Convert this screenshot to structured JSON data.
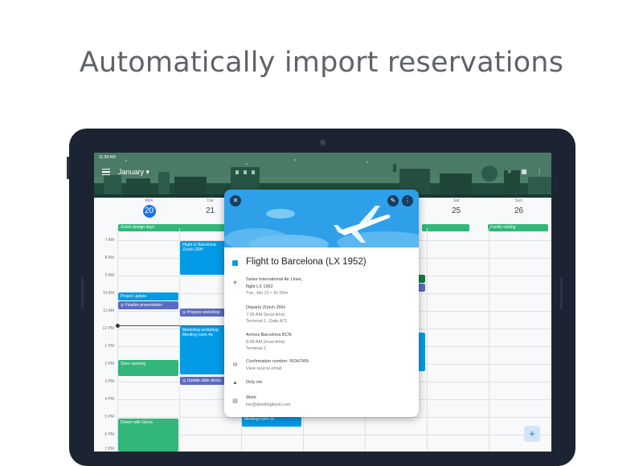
{
  "headline": "Automatically import reservations",
  "status": {
    "time": "11:58 AM"
  },
  "appbar": {
    "month": "January"
  },
  "days": [
    {
      "dow": "Mon",
      "num": "20",
      "today": true
    },
    {
      "dow": "Tue",
      "num": "21"
    },
    {
      "dow": "Sat",
      "num": "25"
    },
    {
      "dow": "Sun",
      "num": "26"
    }
  ],
  "allday": [
    {
      "label": "Zürich design days"
    },
    {
      "label": "Family visiting"
    }
  ],
  "times": [
    "7 AM",
    "8 AM",
    "9 AM",
    "10 AM",
    "11 AM",
    "12 PM",
    "1 PM",
    "2 PM",
    "3 PM",
    "4 PM",
    "5 PM",
    "6 PM",
    "7 PM"
  ],
  "events": {
    "flight": "Flight to Barcelona",
    "flight_sub": "Zürich ZRH",
    "project": "Project update",
    "finalize": "Finalize presentation",
    "prepare": "Prepare workshop",
    "marketing": "Marketing workshop",
    "marketing_room": "Meeting room 4a",
    "store": "Store opening",
    "update_slides": "Update slide decks",
    "dinner": "Dinner with Gloria",
    "meeting": "Meeting room 2c"
  },
  "card": {
    "title": "Flight to Barcelona (LX 1952)",
    "airline_1": "Swiss International Air Lines,",
    "airline_2": "flight LX 1952",
    "airline_3": "Tue, Jan 21 • 1h 53m",
    "dep_1": "Departs Zürich ZRH",
    "dep_2": "7:05 AM (local time)",
    "dep_3": "Terminal 1, Gate A71",
    "arr_1": "Arrives Barcelona BCN",
    "arr_2": "8:58 AM (local time)",
    "arr_3": "Terminal 1",
    "conf_1": "Confirmation number: ROH7W9",
    "conf_2": "View source email",
    "privacy": "Only me",
    "cal_1": "Work",
    "cal_2": "lori@dwellingfund.com"
  },
  "icons": {
    "close": "close-icon",
    "edit": "pencil-icon",
    "more": "more-vert-icon",
    "flight": "airplane-icon",
    "email": "email-icon",
    "lock": "lock-icon",
    "calendar": "calendar-icon",
    "add": "add-icon"
  },
  "colors": {
    "accent": "#1a73e8",
    "event_blue": "#039be5",
    "event_green": "#33b679",
    "event_indigo": "#5c6bc0"
  }
}
